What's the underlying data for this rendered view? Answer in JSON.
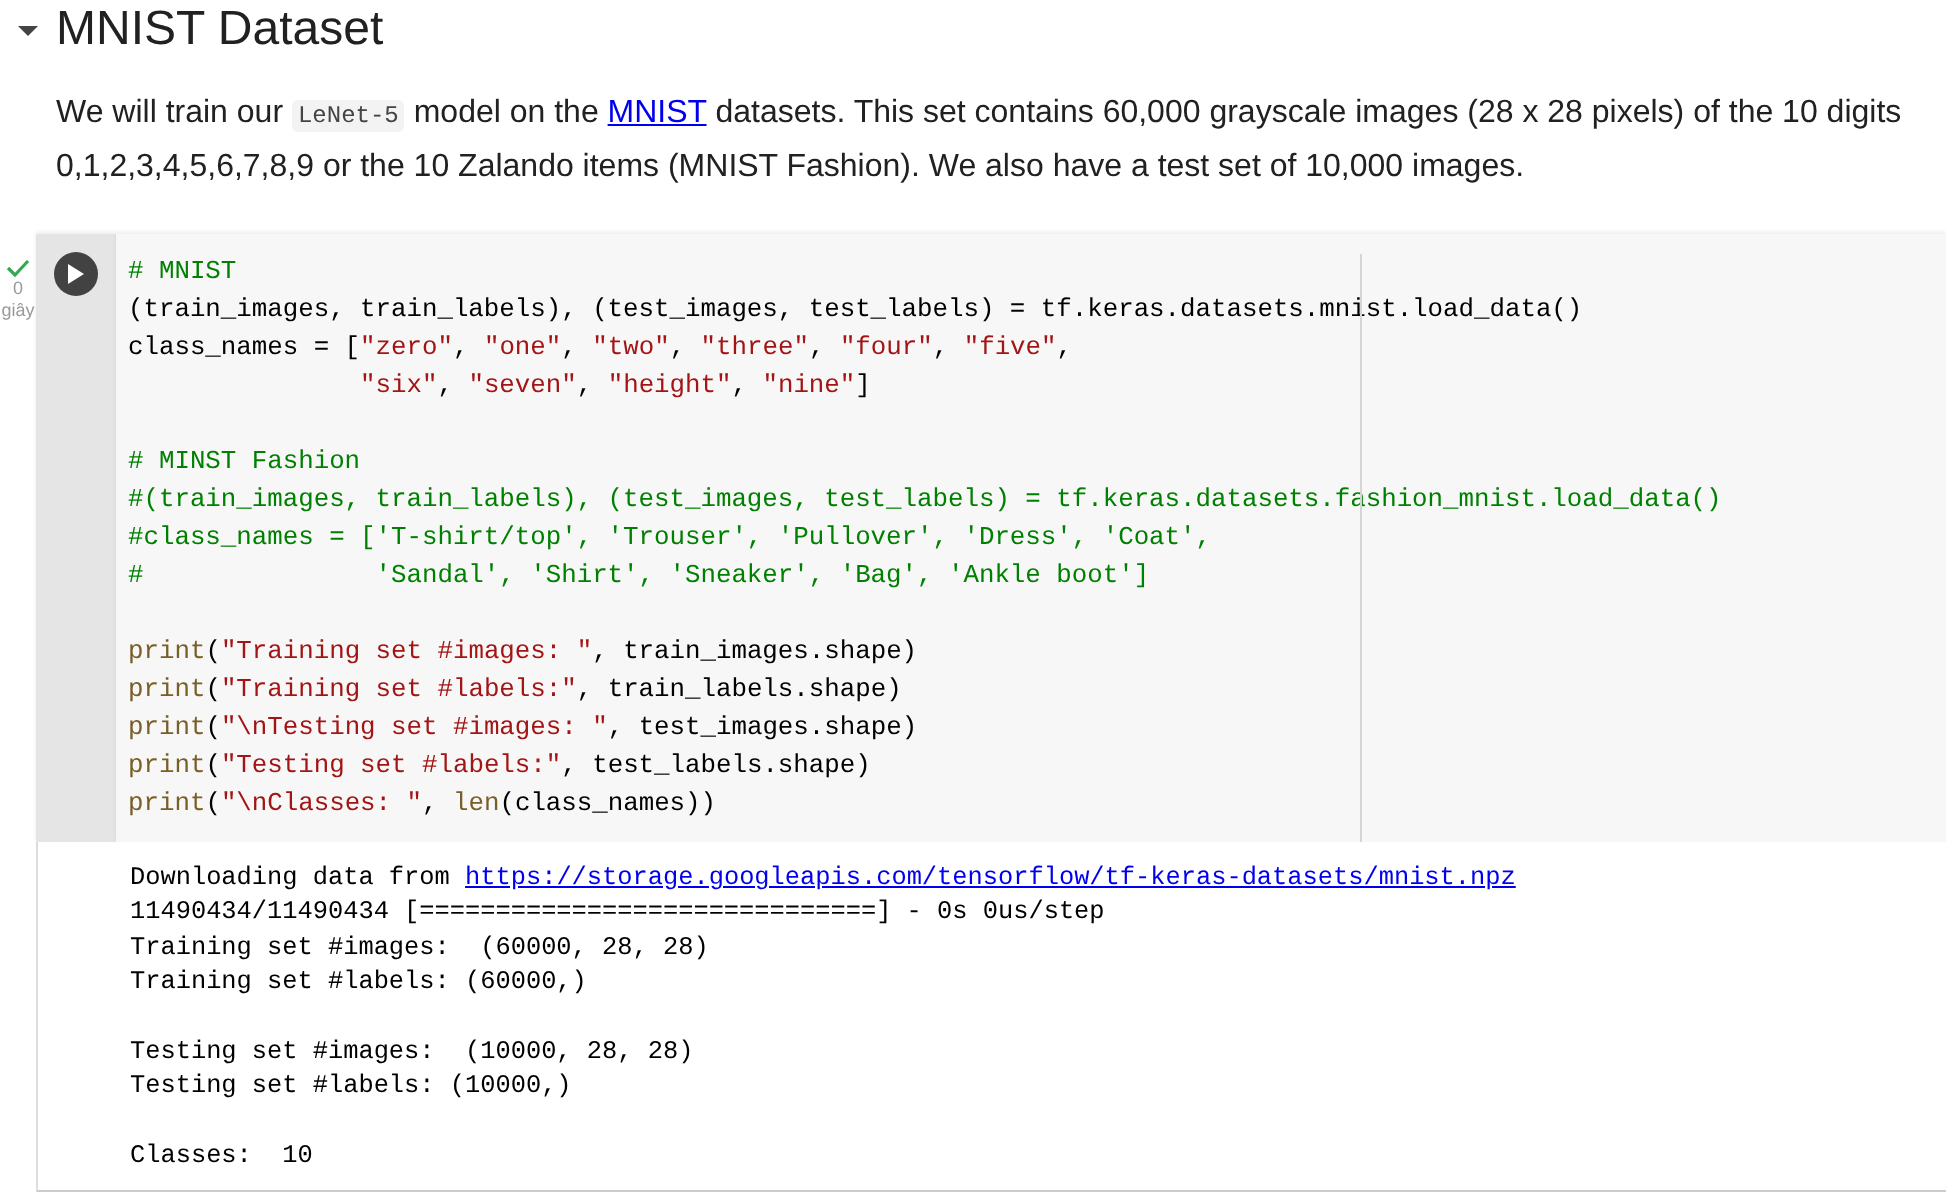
{
  "section": {
    "expanded": true,
    "title": "MNIST Dataset"
  },
  "paragraph": [
    {
      "kind": "text",
      "text": "We will train our "
    },
    {
      "kind": "code",
      "text": "LeNet-5"
    },
    {
      "kind": "text",
      "text": " model on the "
    },
    {
      "kind": "link",
      "text": "MNIST"
    },
    {
      "kind": "text",
      "text": " datasets. This set contains 60,000 grayscale images (28 x 28 pixels) of the 10 digits 0,1,2,3,4,5,6,7,8,9 or the 10 Zalando items (MNIST Fashion). We also have a test set of 10,000 images."
    }
  ],
  "cell": {
    "status": {
      "done": true,
      "duration": "0",
      "unit": "giây"
    },
    "code_blocks": [
      [
        [
          {
            "kind": "comment",
            "text": "# MNIST"
          }
        ],
        [
          {
            "kind": "plain",
            "text": "(train_images, train_labels), (test_images, test_labels) = tf.keras.datasets.mnist.load_data()"
          }
        ],
        [
          {
            "kind": "plain",
            "text": "class_names = ["
          },
          {
            "kind": "string",
            "text": "\"zero\""
          },
          {
            "kind": "plain",
            "text": ", "
          },
          {
            "kind": "string",
            "text": "\"one\""
          },
          {
            "kind": "plain",
            "text": ", "
          },
          {
            "kind": "string",
            "text": "\"two\""
          },
          {
            "kind": "plain",
            "text": ", "
          },
          {
            "kind": "string",
            "text": "\"three\""
          },
          {
            "kind": "plain",
            "text": ", "
          },
          {
            "kind": "string",
            "text": "\"four\""
          },
          {
            "kind": "plain",
            "text": ", "
          },
          {
            "kind": "string",
            "text": "\"five\""
          },
          {
            "kind": "plain",
            "text": ","
          }
        ],
        [
          {
            "kind": "indent"
          },
          {
            "kind": "string",
            "text": "\"six\""
          },
          {
            "kind": "plain",
            "text": ", "
          },
          {
            "kind": "string",
            "text": "\"seven\""
          },
          {
            "kind": "plain",
            "text": ", "
          },
          {
            "kind": "string",
            "text": "\"height\""
          },
          {
            "kind": "plain",
            "text": ", "
          },
          {
            "kind": "string",
            "text": "\"nine\""
          },
          {
            "kind": "plain",
            "text": "]"
          }
        ]
      ],
      [
        [
          {
            "kind": "comment",
            "text": "# MINST Fashion"
          }
        ],
        [
          {
            "kind": "comment",
            "text": "#(train_images, train_labels), (test_images, test_labels) = tf.keras.datasets.fashion_mnist.load_data()"
          }
        ],
        [
          {
            "kind": "comment",
            "text": "#class_names = ['T-shirt/top', 'Trouser', 'Pullover', 'Dress', 'Coat',"
          }
        ],
        [
          {
            "kind": "comment",
            "text": "#               'Sandal', 'Shirt', 'Sneaker', 'Bag', 'Ankle boot']"
          }
        ]
      ],
      [
        [
          {
            "kind": "builtin",
            "text": "print"
          },
          {
            "kind": "plain",
            "text": "("
          },
          {
            "kind": "string",
            "text": "\"Training set #images: \""
          },
          {
            "kind": "plain",
            "text": ", train_images.shape)"
          }
        ],
        [
          {
            "kind": "builtin",
            "text": "print"
          },
          {
            "kind": "plain",
            "text": "("
          },
          {
            "kind": "string",
            "text": "\"Training set #labels:\""
          },
          {
            "kind": "plain",
            "text": ", train_labels.shape)"
          }
        ],
        [
          {
            "kind": "builtin",
            "text": "print"
          },
          {
            "kind": "plain",
            "text": "("
          },
          {
            "kind": "string",
            "text": "\"\\nTesting set #images: \""
          },
          {
            "kind": "plain",
            "text": ", test_images.shape)"
          }
        ],
        [
          {
            "kind": "builtin",
            "text": "print"
          },
          {
            "kind": "plain",
            "text": "("
          },
          {
            "kind": "string",
            "text": "\"Testing set #labels:\""
          },
          {
            "kind": "plain",
            "text": ", test_labels.shape)"
          }
        ],
        [
          {
            "kind": "builtin",
            "text": "print"
          },
          {
            "kind": "plain",
            "text": "("
          },
          {
            "kind": "string",
            "text": "\"\\nClasses: \""
          },
          {
            "kind": "plain",
            "text": ", "
          },
          {
            "kind": "builtin",
            "text": "len"
          },
          {
            "kind": "plain",
            "text": "(class_names))"
          }
        ]
      ]
    ],
    "output_blocks": [
      [
        [
          {
            "kind": "plain",
            "text": "Downloading data from "
          },
          {
            "kind": "link",
            "text": "https://storage.googleapis.com/tensorflow/tf-keras-datasets/mnist.npz"
          }
        ],
        [
          {
            "kind": "plain",
            "text": "11490434/11490434 [==============================] - 0s 0us/step"
          }
        ],
        [
          {
            "kind": "plain",
            "text": "Training set #images:  (60000, 28, 28)"
          }
        ],
        [
          {
            "kind": "plain",
            "text": "Training set #labels: (60000,)"
          }
        ]
      ],
      [
        [
          {
            "kind": "plain",
            "text": "Testing set #images:  (10000, 28, 28)"
          }
        ],
        [
          {
            "kind": "plain",
            "text": "Testing set #labels: (10000,)"
          }
        ]
      ],
      [
        [
          {
            "kind": "plain",
            "text": "Classes:  10"
          }
        ]
      ]
    ]
  }
}
